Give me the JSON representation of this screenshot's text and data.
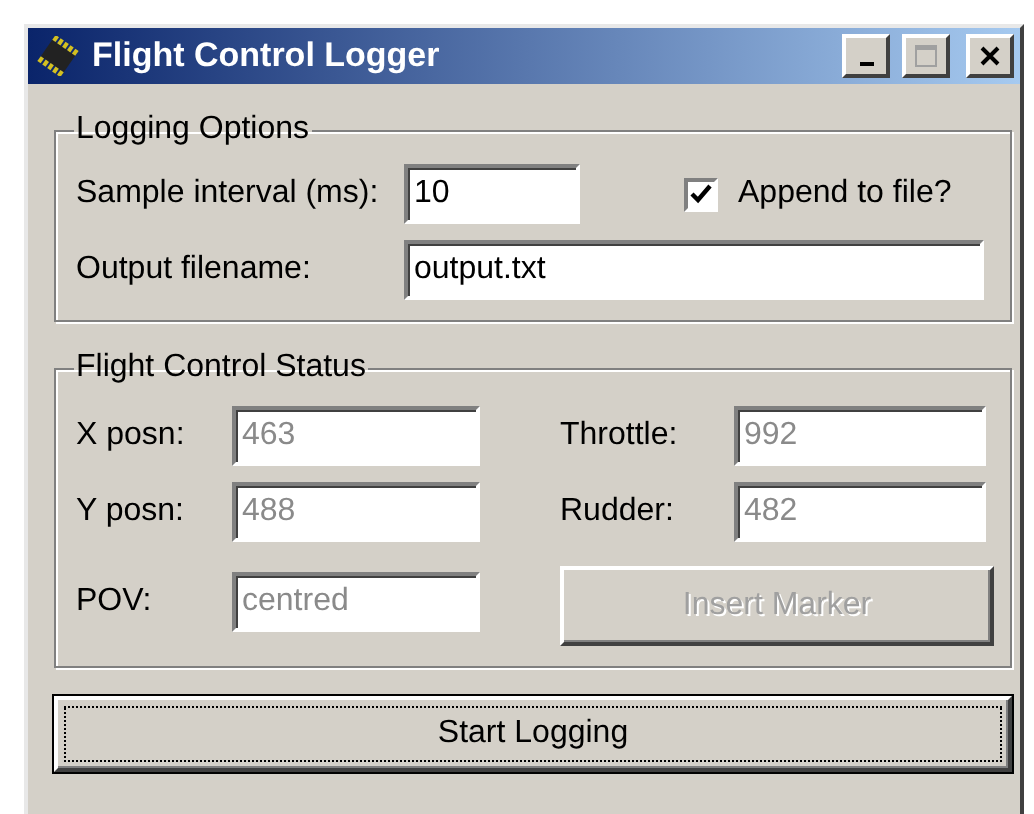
{
  "window": {
    "title": "Flight Control Logger"
  },
  "logging_options": {
    "title": "Logging Options",
    "sample_interval": {
      "label": "Sample interval (ms):",
      "value": "10"
    },
    "append": {
      "label": "Append to file?",
      "checked": true
    },
    "output_filename": {
      "label": "Output filename:",
      "value": "output.txt"
    }
  },
  "status": {
    "title": "Flight Control Status",
    "fields": [
      {
        "label": "X posn:",
        "value": "463",
        "disabled": true
      },
      {
        "label": "Throttle:",
        "value": "992",
        "disabled": true
      },
      {
        "label": "Y posn:",
        "value": "488",
        "disabled": true
      },
      {
        "label": "Rudder:",
        "value": "482",
        "disabled": true
      },
      {
        "label": "POV:",
        "value": "centred",
        "disabled": true
      }
    ],
    "insert_marker": {
      "label": "Insert Marker",
      "disabled": true
    }
  },
  "start_button": {
    "label": "Start Logging",
    "focused": true
  }
}
